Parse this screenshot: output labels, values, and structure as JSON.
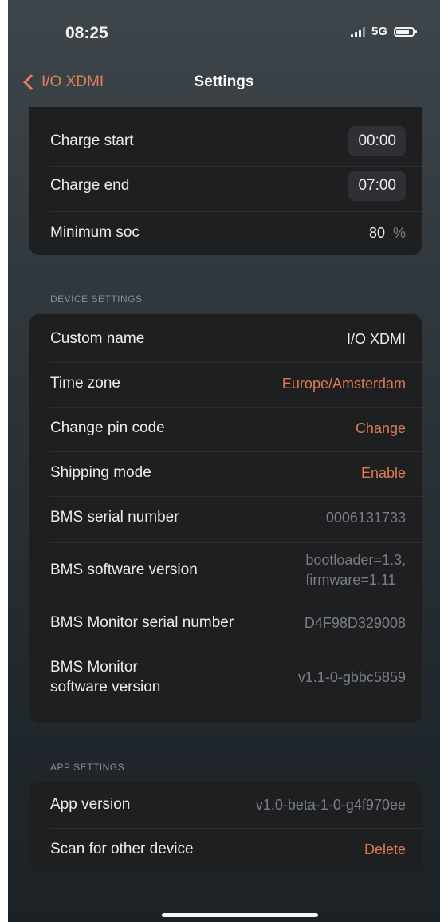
{
  "status_bar": {
    "time": "08:25",
    "network": "5G"
  },
  "nav": {
    "back_label": "I/O XDMI",
    "title": "Settings"
  },
  "charge_settings": {
    "charge_start": {
      "label": "Charge start",
      "value": "00:00"
    },
    "charge_end": {
      "label": "Charge end",
      "value": "07:00"
    },
    "minimum_soc": {
      "label": "Minimum soc",
      "value": "80",
      "unit": "%"
    }
  },
  "device_settings": {
    "header": "DEVICE SETTINGS",
    "rows": [
      {
        "label": "Custom name",
        "value": "I/O XDMI"
      },
      {
        "label": "Time zone",
        "value": "Europe/Amsterdam"
      },
      {
        "label": "Change pin code",
        "value": "Change"
      },
      {
        "label": "Shipping mode",
        "value": "Enable"
      },
      {
        "label": "BMS serial number",
        "value": "0006131733"
      },
      {
        "label": "BMS software version",
        "value_line1": "bootloader=1.3,",
        "value_line2": "firmware=1.11"
      },
      {
        "label": "BMS Monitor serial number",
        "value": "D4F98D329008"
      },
      {
        "label_line1": "BMS Monitor",
        "label_line2": "software version",
        "value": "v1.1-0-gbbc5859"
      }
    ]
  },
  "app_settings": {
    "header": "APP SETTINGS",
    "rows": [
      {
        "label": "App version",
        "value": "v1.0-beta-1-0-g4f970ee"
      },
      {
        "label": "Scan for other device",
        "value": "Delete"
      }
    ]
  },
  "colors": {
    "accent": "#dd7a52",
    "card_background": "#1e1f21",
    "secondary_text": "#7a7e82"
  }
}
